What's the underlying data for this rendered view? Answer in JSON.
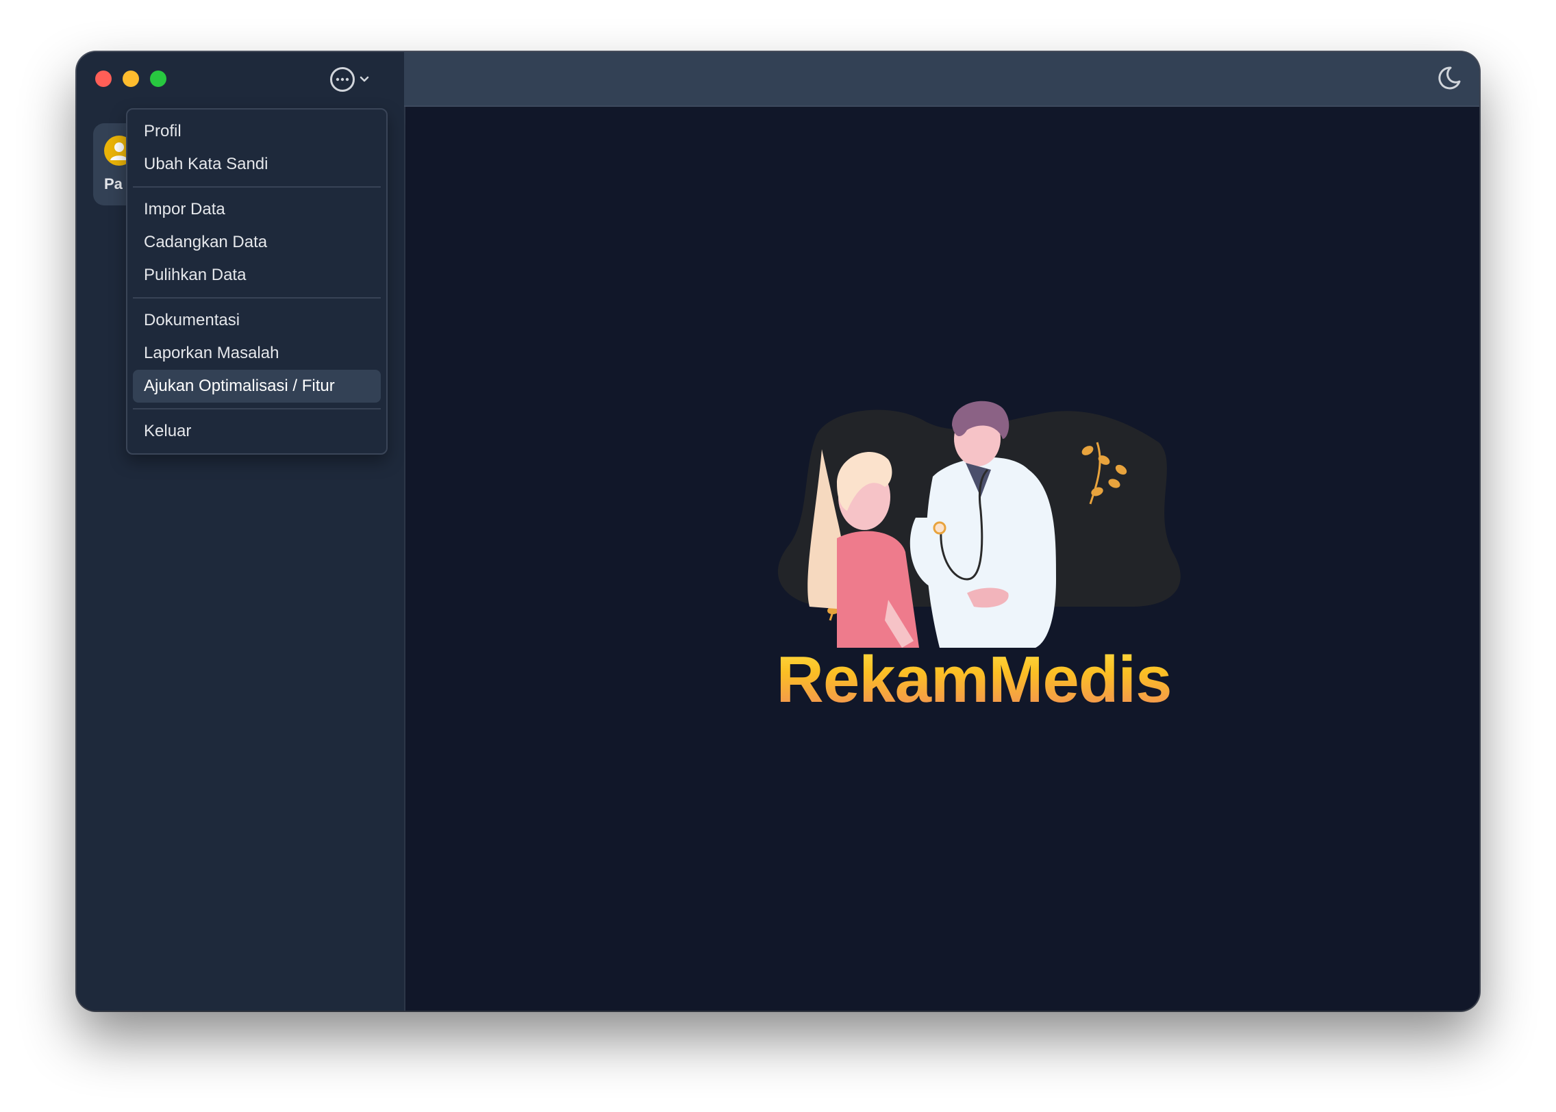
{
  "window": {
    "title": "RekamMedis"
  },
  "sidebar": {
    "nav_items": [
      {
        "label": "Pasien",
        "icon": "user-icon",
        "visible_text": "Pa"
      }
    ]
  },
  "menu": {
    "groups": [
      [
        "Profil",
        "Ubah Kata Sandi"
      ],
      [
        "Impor Data",
        "Cadangkan Data",
        "Pulihkan Data"
      ],
      [
        "Dokumentasi",
        "Laporkan Masalah",
        "Ajukan Optimalisasi / Fitur"
      ],
      [
        "Keluar"
      ]
    ],
    "items": {
      "profil": "Profil",
      "ubah_kata_sandi": "Ubah Kata Sandi",
      "impor_data": "Impor Data",
      "cadangkan_data": "Cadangkan Data",
      "pulihkan_data": "Pulihkan Data",
      "dokumentasi": "Dokumentasi",
      "laporkan_masalah": "Laporkan Masalah",
      "ajukan_optimalisasi": "Ajukan Optimalisasi / Fitur",
      "keluar": "Keluar"
    },
    "highlighted": "Ajukan Optimalisasi / Fitur"
  },
  "main": {
    "brand_name": "RekamMedis"
  },
  "icons": {
    "more": "more-horizontal-icon",
    "chevron": "chevron-down-icon",
    "theme": "moon-icon"
  },
  "colors": {
    "sidebar_bg": "#1e293b",
    "main_bg": "#111729",
    "topbar_bg": "#334155",
    "brand_gradient_top": "#fde047",
    "brand_gradient_bottom": "#f08a5d",
    "avatar": "#eab308"
  }
}
